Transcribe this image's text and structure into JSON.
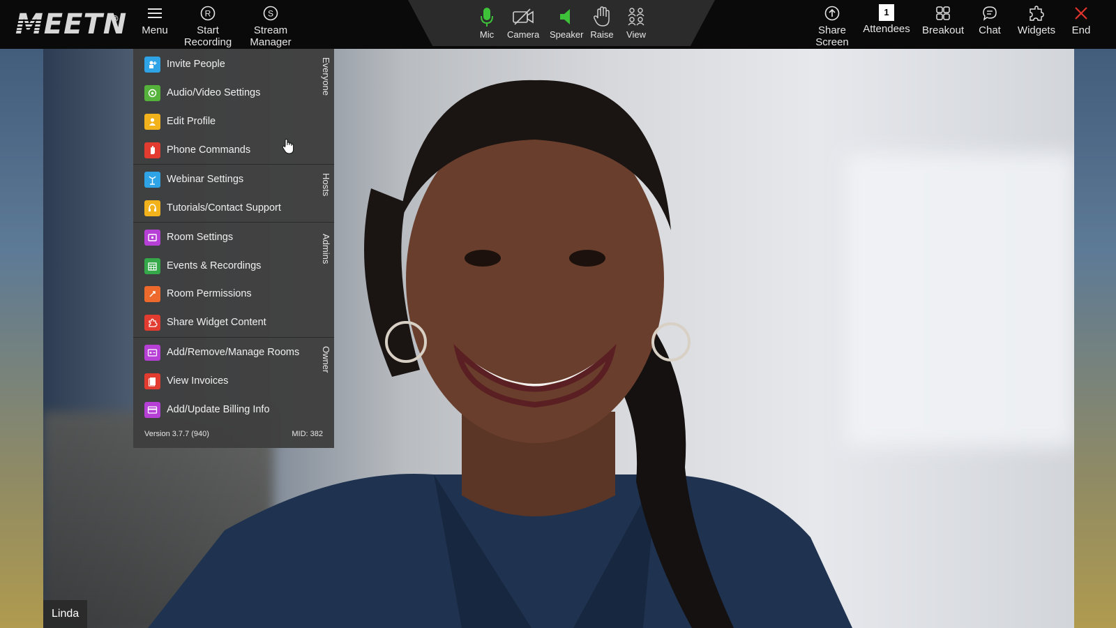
{
  "app": {
    "logo_text": "MEETN",
    "logo_reg": "®"
  },
  "toolbar_left": {
    "menu": {
      "label": "Menu",
      "icon": "hamburger-icon"
    },
    "start_recording": {
      "label": "Start\nRecording",
      "icon": "record-icon"
    },
    "stream_manager": {
      "label": "Stream\nManager",
      "icon": "stream-icon"
    }
  },
  "toolbar_center": {
    "mic": {
      "label": "Mic",
      "icon": "microphone-icon",
      "color": "#3ec23a"
    },
    "camera": {
      "label": "Camera",
      "icon": "camera-off-icon"
    },
    "speaker": {
      "label": "Speaker",
      "icon": "speaker-icon",
      "color": "#3ec23a"
    },
    "raise": {
      "label": "Raise",
      "icon": "hand-icon"
    },
    "view": {
      "label": "View",
      "icon": "grid-people-icon"
    }
  },
  "toolbar_right": {
    "share_screen": {
      "label": "Share\nScreen",
      "icon": "share-screen-icon"
    },
    "attendees": {
      "label": "Attendees",
      "count": "1",
      "icon": "attendees-icon"
    },
    "breakout": {
      "label": "Breakout",
      "icon": "breakout-icon"
    },
    "chat": {
      "label": "Chat",
      "icon": "chat-icon"
    },
    "widgets": {
      "label": "Widgets",
      "icon": "widgets-icon"
    },
    "end": {
      "label": "End",
      "icon": "close-icon",
      "color": "#e0342c"
    }
  },
  "menu": {
    "sections": {
      "everyone": "Everyone",
      "hosts": "Hosts",
      "admins": "Admins",
      "owner": "Owner"
    },
    "items": [
      {
        "label": "Invite People",
        "icon": "invite-icon",
        "color": "#2ea3e6"
      },
      {
        "label": "Audio/Video Settings",
        "icon": "av-settings-icon",
        "color": "#55b33b"
      },
      {
        "label": "Edit Profile",
        "icon": "profile-icon",
        "color": "#f2b21b"
      },
      {
        "label": "Phone Commands",
        "icon": "phone-commands-icon",
        "color": "#e23b2f"
      },
      {
        "label": "Webinar Settings",
        "icon": "webinar-icon",
        "color": "#2ea3e6"
      },
      {
        "label": "Tutorials/Contact Support",
        "icon": "support-icon",
        "color": "#f2b21b"
      },
      {
        "label": "Room Settings",
        "icon": "room-settings-icon",
        "color": "#b63fd6"
      },
      {
        "label": "Events & Recordings",
        "icon": "calendar-icon",
        "color": "#35a84a"
      },
      {
        "label": "Room Permissions",
        "icon": "permissions-icon",
        "color": "#ee6a2c"
      },
      {
        "label": "Share Widget Content",
        "icon": "widget-share-icon",
        "color": "#e23b2f"
      },
      {
        "label": "Add/Remove/Manage Rooms",
        "icon": "manage-rooms-icon",
        "color": "#b63fd6"
      },
      {
        "label": "View Invoices",
        "icon": "invoices-icon",
        "color": "#e23b2f"
      },
      {
        "label": "Add/Update Billing Info",
        "icon": "billing-icon",
        "color": "#b63fd6"
      }
    ],
    "version": "Version 3.7.7 (940)",
    "mid": "MID: 382"
  },
  "video": {
    "participant_name": "Linda"
  }
}
